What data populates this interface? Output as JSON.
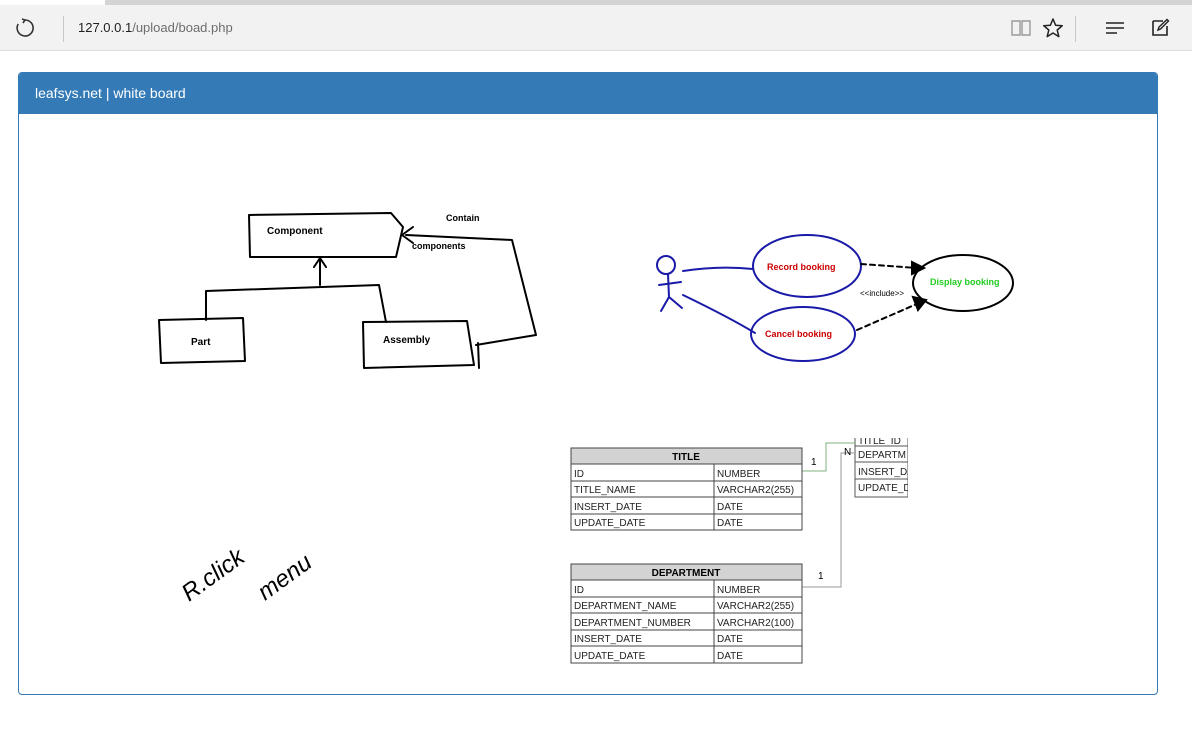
{
  "browser": {
    "url_host": "127.0.0.1",
    "url_path": "/upload/boad.php",
    "icons": [
      "refresh-icon",
      "reading-view-icon",
      "favorite-star-icon",
      "hub-menu-icon",
      "web-note-icon"
    ]
  },
  "panel": {
    "title": "leafsys.net | white board"
  },
  "class_diagram": {
    "component": "Component",
    "part": "Part",
    "assembly": "Assembly",
    "relation_line1": "Contain",
    "relation_line2": "components"
  },
  "use_case_diagram": {
    "record": "Record booking",
    "cancel": "Cancel booking",
    "display": "Display booking",
    "include": "<<include>>",
    "colors": {
      "actor": "#1a1aa8",
      "case_text": "#cc0000",
      "display_text": "#22cc22"
    }
  },
  "er_diagram": {
    "title_table": {
      "name": "TITLE",
      "rows": [
        [
          "ID",
          "NUMBER"
        ],
        [
          "TITLE_NAME",
          "VARCHAR2(255)"
        ],
        [
          "INSERT_DATE",
          "DATE"
        ],
        [
          "UPDATE_DATE",
          "DATE"
        ]
      ]
    },
    "department_table": {
      "name": "DEPARTMENT",
      "rows": [
        [
          "ID",
          "NUMBER"
        ],
        [
          "DEPARTMENT_NAME",
          "VARCHAR2(255)"
        ],
        [
          "DEPARTMENT_NUMBER",
          "VARCHAR2(100)"
        ],
        [
          "INSERT_DATE",
          "DATE"
        ],
        [
          "UPDATE_DATE",
          "DATE"
        ]
      ]
    },
    "partial_table": {
      "rows": [
        "TITLE_ID",
        "DEPARTM",
        "INSERT_DA",
        "UPDATE_D"
      ]
    },
    "cardinality_title": "1",
    "cardinality_n": "N",
    "cardinality_dept": "1"
  },
  "handwriting": {
    "line1": "R.click",
    "line2": "menu"
  }
}
